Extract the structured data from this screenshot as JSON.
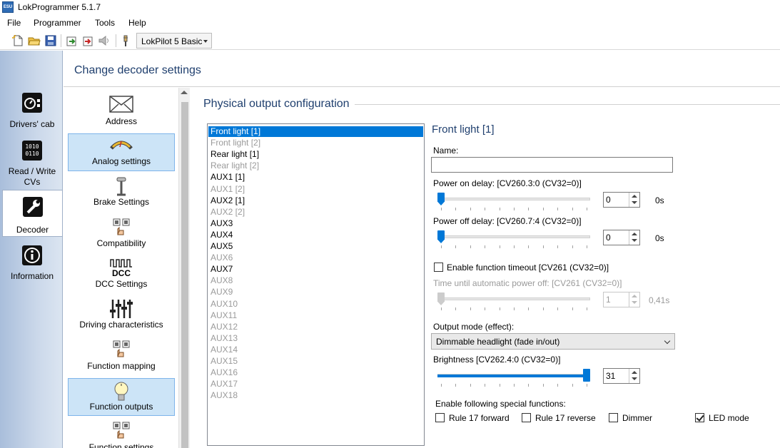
{
  "app": {
    "title": "LokProgrammer 5.1.7",
    "icon_text": "ESU"
  },
  "menu": [
    "File",
    "Programmer",
    "Tools",
    "Help"
  ],
  "toolbar": {
    "icons": [
      "new-file-icon",
      "open-folder-icon",
      "save-icon",
      "read-decoder-icon",
      "write-decoder-icon",
      "sound-icon",
      "connect-icon"
    ],
    "decoder_type": "LokPilot 5 Basic"
  },
  "nav": {
    "items": [
      {
        "label": "Drivers' cab",
        "icon": "drivers-cab-icon"
      },
      {
        "label": "Read / Write CVs",
        "icon": "cv-table-icon"
      },
      {
        "label": "Decoder",
        "icon": "wrench-icon",
        "active": true
      },
      {
        "label": "Information",
        "icon": "info-icon"
      }
    ]
  },
  "main": {
    "title": "Change decoder settings"
  },
  "settings": {
    "items": [
      {
        "label": "Address",
        "icon": "envelope-icon"
      },
      {
        "label": "Analog settings",
        "icon": "analog-icon",
        "selected": true
      },
      {
        "label": "Brake Settings",
        "icon": "brake-icon"
      },
      {
        "label": "Compatibility",
        "icon": "compatibility-icon"
      },
      {
        "label": "DCC Settings",
        "icon": "dcc-icon",
        "icon_text": "DCC"
      },
      {
        "label": "Driving characteristics",
        "icon": "sliders-icon"
      },
      {
        "label": "Function mapping",
        "icon": "function-mapping-icon"
      },
      {
        "label": "Function outputs",
        "icon": "bulb-icon",
        "selected": true
      },
      {
        "label": "Function settings",
        "icon": "function-settings-icon"
      }
    ]
  },
  "section": {
    "title": "Physical output configuration"
  },
  "outputs": [
    {
      "label": "Front light [1]",
      "enabled": true,
      "selected": true
    },
    {
      "label": "Front light [2]",
      "enabled": false
    },
    {
      "label": "Rear light [1]",
      "enabled": true
    },
    {
      "label": "Rear light [2]",
      "enabled": false
    },
    {
      "label": "AUX1 [1]",
      "enabled": true
    },
    {
      "label": "AUX1 [2]",
      "enabled": false
    },
    {
      "label": "AUX2 [1]",
      "enabled": true
    },
    {
      "label": "AUX2 [2]",
      "enabled": false
    },
    {
      "label": "AUX3",
      "enabled": true
    },
    {
      "label": "AUX4",
      "enabled": true
    },
    {
      "label": "AUX5",
      "enabled": true
    },
    {
      "label": "AUX6",
      "enabled": false
    },
    {
      "label": "AUX7",
      "enabled": true
    },
    {
      "label": "AUX8",
      "enabled": false
    },
    {
      "label": "AUX9",
      "enabled": false
    },
    {
      "label": "AUX10",
      "enabled": false
    },
    {
      "label": "AUX11",
      "enabled": false
    },
    {
      "label": "AUX12",
      "enabled": false
    },
    {
      "label": "AUX13",
      "enabled": false
    },
    {
      "label": "AUX14",
      "enabled": false
    },
    {
      "label": "AUX15",
      "enabled": false
    },
    {
      "label": "AUX16",
      "enabled": false
    },
    {
      "label": "AUX17",
      "enabled": false
    },
    {
      "label": "AUX18",
      "enabled": false
    }
  ],
  "detail": {
    "title": "Front light [1]",
    "name_label": "Name:",
    "name_value": "",
    "power_on": {
      "label": "Power on delay: [CV260.3:0 (CV32=0)]",
      "value": "0",
      "unit_text": "0s",
      "level": 0
    },
    "power_off": {
      "label": "Power off delay: [CV260.7:4 (CV32=0)]",
      "value": "0",
      "unit_text": "0s",
      "level": 0
    },
    "timeout_checkbox": {
      "label": "Enable function timeout [CV261 (CV32=0)]",
      "checked": false
    },
    "auto_off": {
      "label": "Time until automatic power off: [CV261 (CV32=0)]",
      "value": "1",
      "unit_text": "0,41s",
      "level": 0,
      "enabled": false
    },
    "output_mode": {
      "label": "Output mode (effect):",
      "value": "Dimmable headlight (fade in/out)"
    },
    "brightness": {
      "label": "Brightness [CV262.4:0 (CV32=0)]",
      "value": "31",
      "level": 1.0
    },
    "special": {
      "label": "Enable following special functions:",
      "options": [
        {
          "label": "Rule 17 forward",
          "checked": false
        },
        {
          "label": "Rule 17 reverse",
          "checked": false
        },
        {
          "label": "Dimmer",
          "checked": false
        },
        {
          "label": "LED mode",
          "checked": true
        }
      ]
    }
  },
  "colors": {
    "accent": "#0078d7",
    "heading": "#1f3f6e",
    "selected_bg": "#cce4f7",
    "nav_bg": "#b8c9e1"
  }
}
